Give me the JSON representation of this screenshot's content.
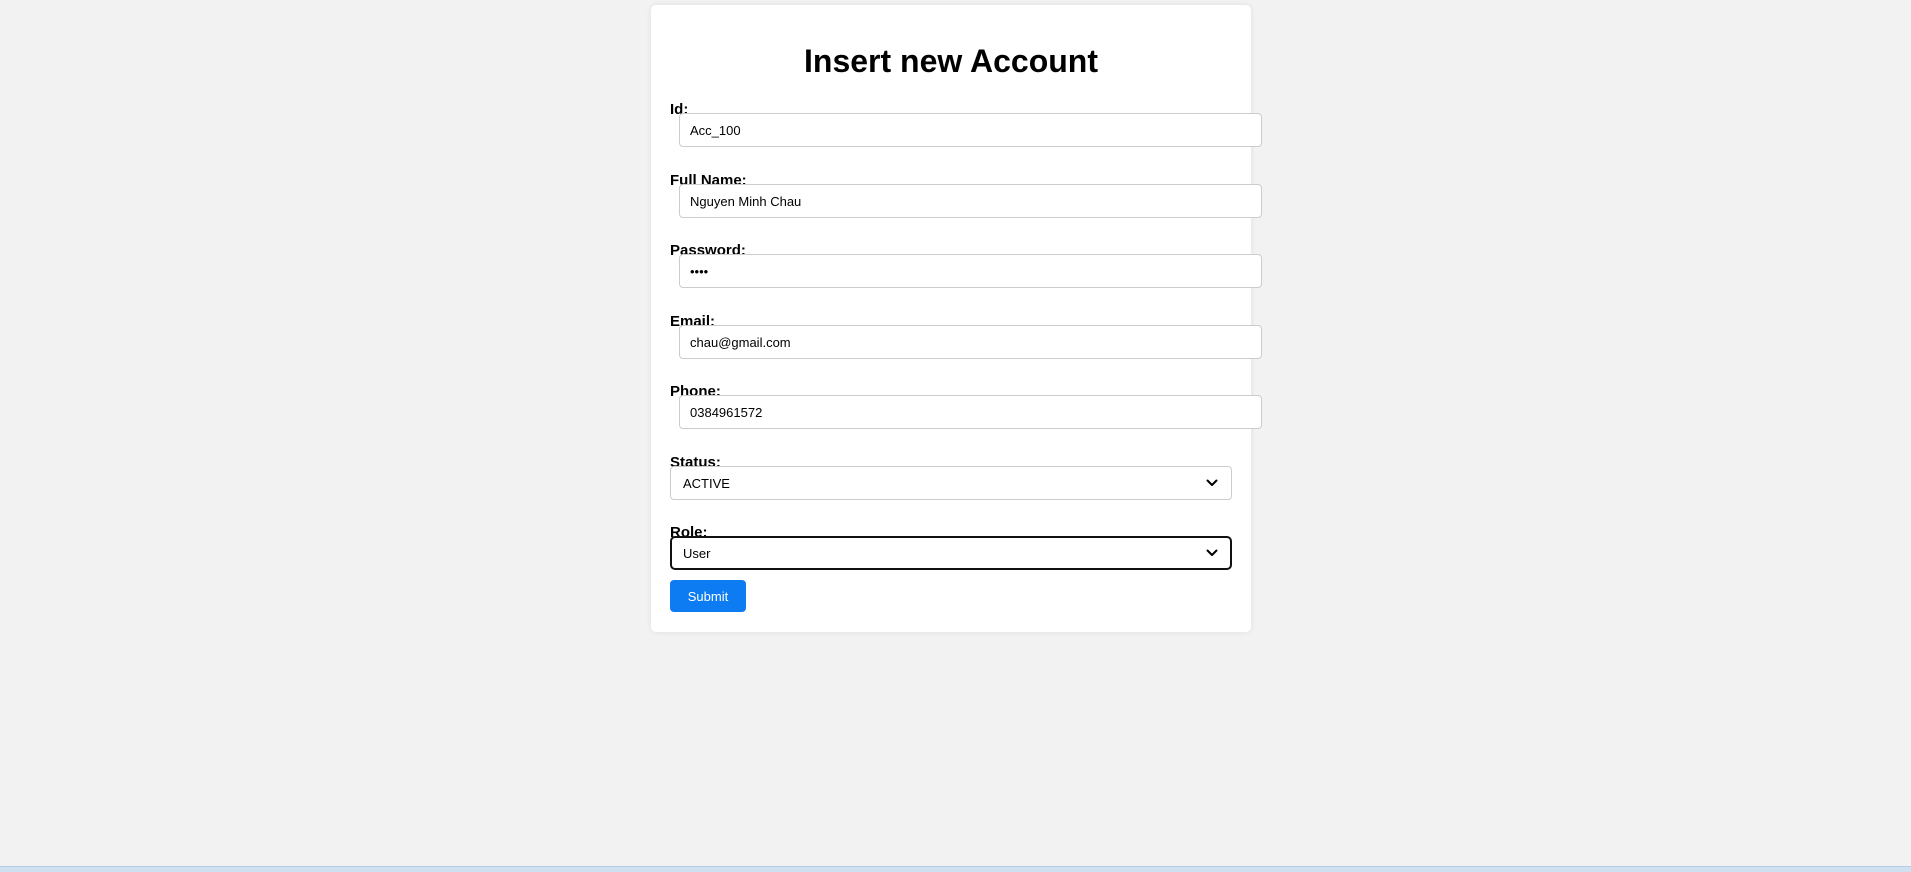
{
  "form": {
    "title": "Insert new Account",
    "fields": {
      "id": {
        "label": "Id:",
        "value": "Acc_100"
      },
      "full_name": {
        "label": "Full Name:",
        "value": "Nguyen Minh Chau"
      },
      "password": {
        "label": "Password:",
        "value": "••••"
      },
      "email": {
        "label": "Email:",
        "value": "chau@gmail.com"
      },
      "phone": {
        "label": "Phone:",
        "value": "0384961572"
      },
      "status": {
        "label": "Status:",
        "selected": "ACTIVE"
      },
      "role": {
        "label": "Role:",
        "selected": "User"
      }
    },
    "submit_label": "Submit"
  },
  "colors": {
    "background": "#f2f2f2",
    "card": "#ffffff",
    "accent": "#0d7cf2",
    "input_border": "#cccccc"
  }
}
